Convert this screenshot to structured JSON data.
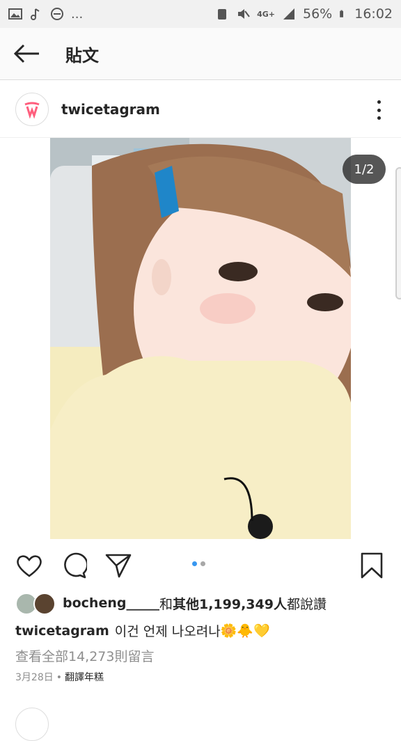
{
  "status_bar": {
    "left_icons": [
      "image-icon",
      "music-note-icon",
      "do-not-disturb-icon"
    ],
    "ellipsis": "...",
    "network": "4G+",
    "battery": "56%",
    "time": "16:02"
  },
  "app_bar": {
    "title": "貼文"
  },
  "post": {
    "username": "twicetagram",
    "image_counter": "1/2",
    "carousel": {
      "count": 2,
      "active_index": 0
    }
  },
  "likes": {
    "user": "bocheng_____",
    "connector": "和",
    "others": "其他1,199,349人",
    "suffix": "都說讚"
  },
  "caption": {
    "username": "twicetagram",
    "text": "이건 언제 나오려나",
    "emojis": "🌼🐥💛"
  },
  "view_comments": "查看全部14,273則留言",
  "date": "3月28日",
  "separator": "•",
  "translate": "翻譯年糕",
  "colors": {
    "accent_blue": "#3897f0",
    "text": "#262626",
    "muted": "#8e8e8e",
    "brand_red": "#ff5f7e"
  }
}
